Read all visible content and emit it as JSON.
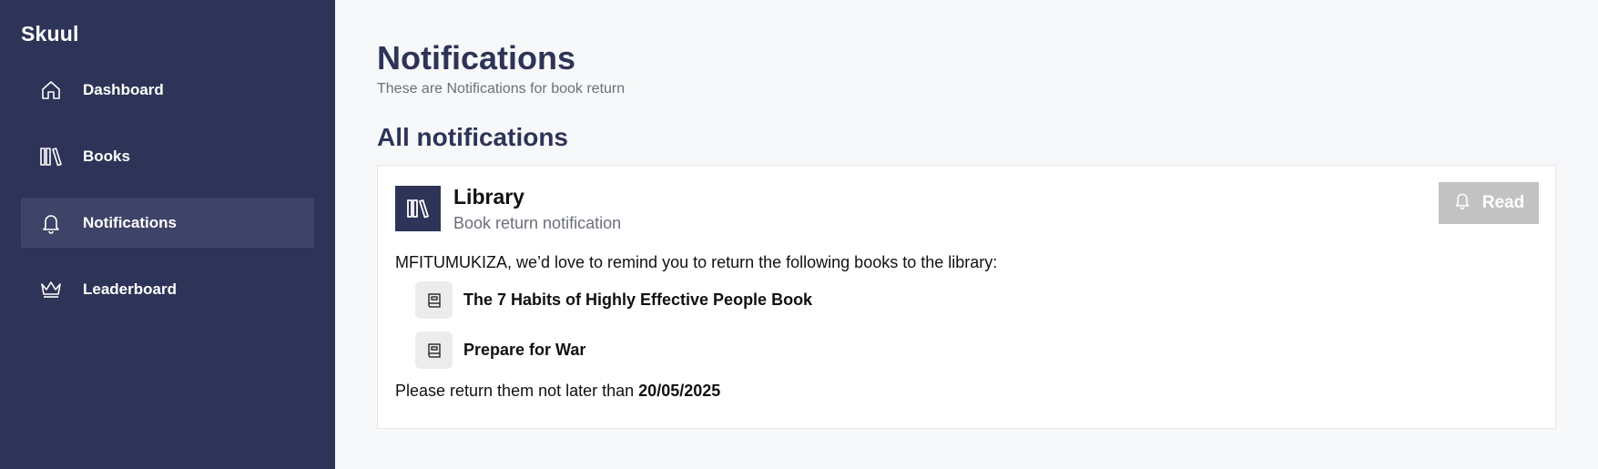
{
  "app": {
    "name": "Skuul"
  },
  "sidebar": {
    "items": [
      {
        "label": "Dashboard",
        "icon": "home-icon",
        "active": false
      },
      {
        "label": "Books",
        "icon": "books-icon",
        "active": false
      },
      {
        "label": "Notifications",
        "icon": "bell-icon",
        "active": true
      },
      {
        "label": "Leaderboard",
        "icon": "crown-icon",
        "active": false
      }
    ]
  },
  "header": {
    "title": "Notifications",
    "subtitle": "These are Notifications for book return"
  },
  "section": {
    "title": "All notifications"
  },
  "notification": {
    "title": "Library",
    "subtitle": "Book return notification",
    "read_label": "Read",
    "message": "MFITUMUKIZA, we’d love to remind you to return the following books to the library:",
    "books": [
      "The 7 Habits of Highly Effective People Book",
      "Prepare for War"
    ],
    "due_prefix": "Please return them not later than",
    "due_date": "20/05/2025"
  },
  "colors": {
    "sidebar_bg": "#2e3457",
    "active_item_bg": "#3e4468",
    "button_disabled": "#c2c2c2"
  }
}
